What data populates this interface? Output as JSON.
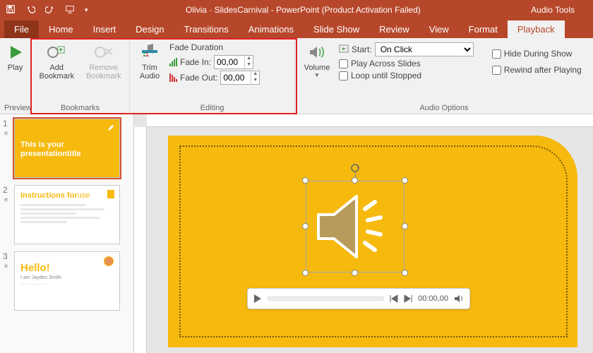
{
  "titlebar": {
    "title": "Olivia · SlidesCarnival - PowerPoint (Product Activation Failed)",
    "context_tab": "Audio Tools"
  },
  "tabs": {
    "file": "File",
    "home": "Home",
    "insert": "Insert",
    "design": "Design",
    "transitions": "Transitions",
    "animations": "Animations",
    "slideshow": "Slide Show",
    "review": "Review",
    "view": "View",
    "format": "Format",
    "playback": "Playback"
  },
  "ribbon": {
    "preview": {
      "play": "Play",
      "group": "Preview"
    },
    "bookmarks": {
      "add": "Add\nBookmark",
      "remove": "Remove\nBookmark",
      "group": "Bookmarks"
    },
    "editing": {
      "trim": "Trim\nAudio",
      "fade_title": "Fade Duration",
      "fade_in_label": "Fade In:",
      "fade_out_label": "Fade Out:",
      "fade_in_value": "00,00",
      "fade_out_value": "00,00",
      "group": "Editing"
    },
    "audio_options": {
      "volume": "Volume",
      "start_label": "Start:",
      "start_value": "On Click",
      "play_across": "Play Across Slides",
      "loop": "Loop until Stopped",
      "hide": "Hide During Show",
      "rewind": "Rewind after Playing",
      "group": "Audio Options"
    }
  },
  "thumbs": {
    "n1": "1",
    "n2": "2",
    "n3": "3",
    "t1_line1": "This is your",
    "t1_line2a": "presentation",
    "t1_line2b": "title",
    "t2_title": "Instructions for",
    "t2_title_b": "use",
    "t3_title": "Hello!",
    "t3_sub": "I am Jayden Smith"
  },
  "player": {
    "time": "00:00,00"
  }
}
